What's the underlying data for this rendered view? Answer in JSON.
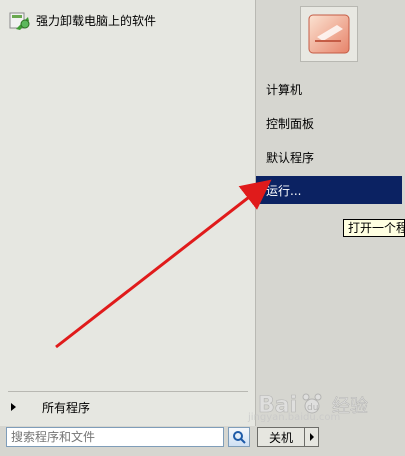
{
  "start_menu": {
    "pinned_programs": [
      {
        "label": "强力卸载电脑上的软件",
        "icon": "uninstall-app-icon"
      }
    ],
    "all_programs_label": "所有程序",
    "search": {
      "placeholder": "搜索程序和文件"
    }
  },
  "right_pane": {
    "items": [
      {
        "label": "计算机"
      },
      {
        "label": "控制面板"
      },
      {
        "label": "默认程序"
      },
      {
        "label": "运行..."
      }
    ],
    "active_index": 3,
    "tooltip": "打开一个程"
  },
  "shutdown": {
    "label": "关机"
  },
  "watermark": {
    "brand": "Baidu",
    "suffix": "经验",
    "url": "jingyan.baidu.com"
  },
  "colors": {
    "highlight": "#0b2262",
    "annotation_arrow": "#e01b1b"
  }
}
